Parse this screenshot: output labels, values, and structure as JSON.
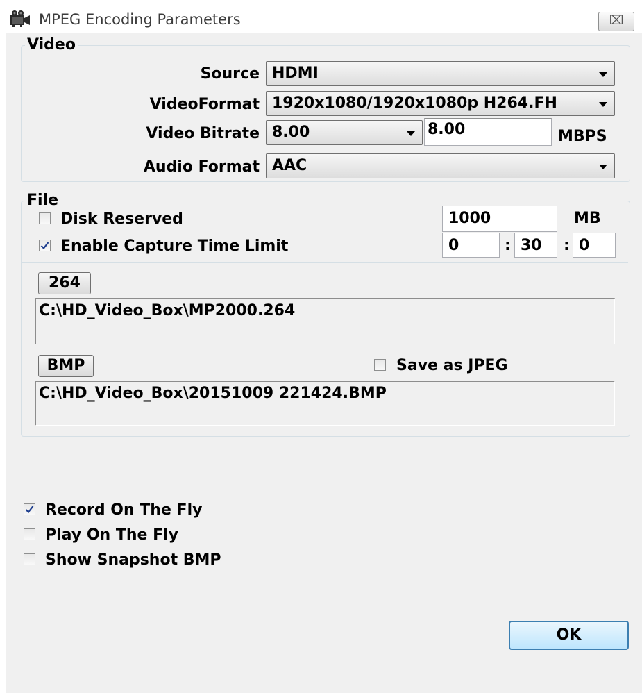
{
  "window": {
    "title": "MPEG Encoding Parameters",
    "close_glyph": "⌧"
  },
  "video": {
    "group_label": "Video",
    "source_label": "Source",
    "source_value": "HDMI",
    "format_label": "VideoFormat",
    "format_value": "1920x1080/1920x1080p H264.FH",
    "bitrate_label": "Video Bitrate",
    "bitrate_select": "8.00",
    "bitrate_value": "8.00",
    "bitrate_unit": "MBPS",
    "audio_label": "Audio Format",
    "audio_value": "AAC"
  },
  "file": {
    "group_label": "File",
    "disk_reserved_label": "Disk Reserved",
    "disk_reserved_checked": false,
    "disk_reserved_value": "1000",
    "disk_reserved_unit": "MB",
    "time_limit_label": "Enable Capture Time Limit",
    "time_limit_checked": true,
    "time_hours": "0",
    "time_minutes": "30",
    "time_seconds": "0",
    "time_sep": ":",
    "h264_button": "264",
    "h264_path": "C:\\HD_Video_Box\\MP2000.264",
    "bmp_button": "BMP",
    "save_jpeg_label": "Save as JPEG",
    "save_jpeg_checked": false,
    "bmp_path": "C:\\HD_Video_Box\\20151009 221424.BMP"
  },
  "options": {
    "record_label": "Record On The Fly",
    "record_checked": true,
    "play_label": "Play On The Fly",
    "play_checked": false,
    "snapshot_label": "Show Snapshot BMP",
    "snapshot_checked": false
  },
  "ok_label": "OK",
  "icons": {
    "app": "camera-icon",
    "checkmark": "checkmark-icon",
    "dropdown": "chevron-down-icon",
    "close": "close-icon"
  },
  "colors": {
    "window_bg": "#f0f0f0",
    "checkmark": "#1f3f8f",
    "ok_border": "#3c7fb1"
  }
}
